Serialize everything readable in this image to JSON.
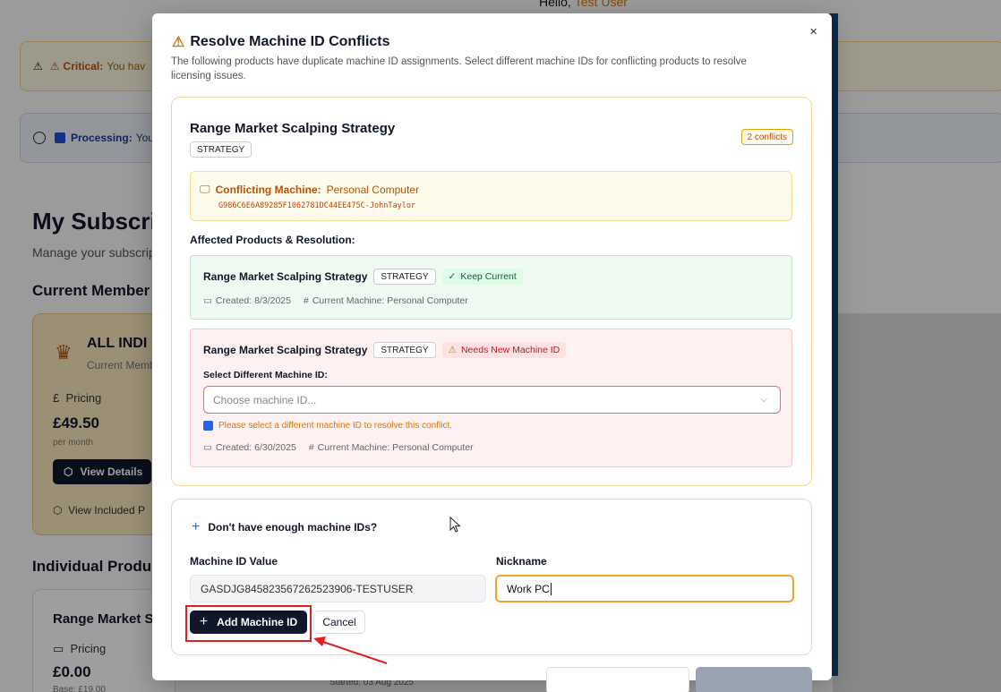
{
  "background": {
    "greeting": "Hello,",
    "user_name": "Test User",
    "critical_label": "Critical:",
    "critical_text": "You hav",
    "processing_label": "Processing:",
    "processing_text": "Your",
    "page_title": "My Subscri",
    "page_subtitle": "Manage your subscrip",
    "current_memberships": "Current Member",
    "individual_products": "Individual Produ",
    "membership_card": {
      "name": "ALL INDI",
      "status": "Current Memb",
      "pricing_label": "Pricing",
      "price": "£49.50",
      "period": "per month",
      "view_details": "View Details",
      "view_included": "View Included P"
    },
    "product_card": {
      "name": "Range Market S",
      "pricing_label": "Pricing",
      "price": "£0.00",
      "base": "Base: £19.00"
    },
    "started": "Started: 03 Aug 2025"
  },
  "dialog": {
    "title": "Resolve Machine ID Conflicts",
    "description": "The following products have duplicate machine ID assignments. Select different machine IDs for conflicting products to resolve licensing issues.",
    "close": "×",
    "conflict": {
      "product_name": "Range Market Scalping Strategy",
      "product_type": "STRATEGY",
      "conflicts_badge": "2 conflicts",
      "machine_label": "Conflicting Machine:",
      "machine_name": "Personal Computer",
      "machine_id": "G986C6E6A89285F1062781DC44EE475C-JohnTaylor",
      "affected_heading": "Affected Products & Resolution:",
      "keep": {
        "product_name": "Range Market Scalping Strategy",
        "type": "STRATEGY",
        "status": "Keep Current",
        "created": "Created: 8/3/2025",
        "current_machine": "Current Machine: Personal Computer"
      },
      "needs": {
        "product_name": "Range Market Scalping Strategy",
        "type": "STRATEGY",
        "status": "Needs New Machine ID",
        "select_label": "Select Different Machine ID:",
        "select_placeholder": "Choose machine ID...",
        "hint": "Please select a different machine ID to resolve this conflict.",
        "created": "Created: 6/30/2025",
        "current_machine": "Current Machine: Personal Computer"
      }
    },
    "add_machine": {
      "toggle": "Don't have enough machine IDs?",
      "value_label": "Machine ID Value",
      "value": "GASDJG845823567262523906-TESTUSER",
      "nickname_label": "Nickname",
      "nickname": "Work PC",
      "add_button": "Add Machine ID",
      "cancel_button": "Cancel"
    }
  },
  "colors": {
    "accent_dark": "#0f172a",
    "warning": "#d97706",
    "error_border": "#e76b6b",
    "focus_border": "#f0a42a",
    "annotation_red": "#e11d1d"
  }
}
